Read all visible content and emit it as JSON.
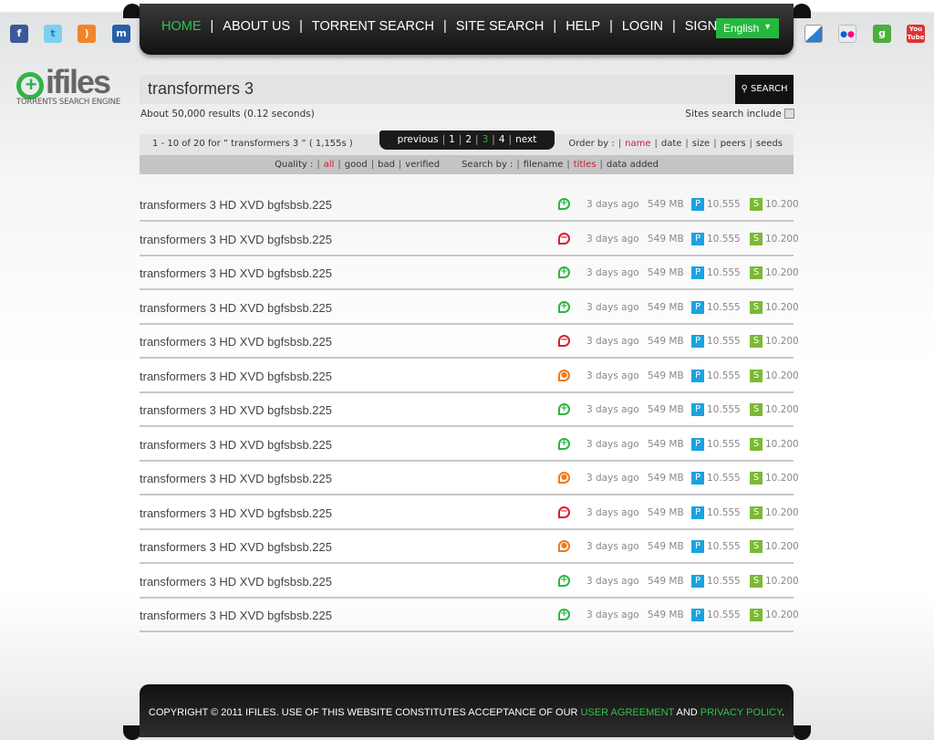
{
  "nav": {
    "items": [
      "HOME",
      "ABOUT US",
      "TORRENT SEARCH",
      "SITE SEARCH",
      "HELP",
      "LOGIN",
      "SIGNIN"
    ],
    "active": 0,
    "language": "English"
  },
  "social_left": [
    "facebook",
    "twitter",
    "rss",
    "myspace"
  ],
  "social_right": [
    "delicious",
    "flickr",
    "google",
    "youtube"
  ],
  "logo": {
    "name": "ifiles",
    "tagline": "TORRENTS SEARCH ENGINE"
  },
  "search": {
    "query": "transformers 3",
    "button": "SEARCH",
    "results_info": "About 50,000 results (0.12 seconds)",
    "sites_include": "Sites search include"
  },
  "summary": "1  -  10  of  20  for ”  transformers 3 ”  (  1,155s  )",
  "pager": {
    "previous": "previous",
    "pages": [
      "1",
      "2",
      "3",
      "4"
    ],
    "current": "3",
    "next": "next"
  },
  "order": {
    "label": "Order by :",
    "options": [
      "name",
      "date",
      "size",
      "peers",
      "seeds"
    ],
    "active": "name"
  },
  "quality": {
    "label": "Quality :",
    "options": [
      "all",
      "good",
      "bad",
      "verified"
    ],
    "active": "all"
  },
  "searchby": {
    "label": "Search by :",
    "options": [
      "filename",
      "titles",
      "data added"
    ],
    "active": "titles"
  },
  "colors": {
    "good": "#2fb545",
    "bad": "#d8202f",
    "unverified": "#f07a1c"
  },
  "results": [
    {
      "title": "transformers 3  HD XVD bgfsbsb.225",
      "status": "good",
      "age": "3 days ago",
      "size": "549 MB",
      "peers": "10.555",
      "seeds": "10.200"
    },
    {
      "title": "transformers 3  HD XVD bgfsbsb.225",
      "status": "bad",
      "age": "3 days ago",
      "size": "549 MB",
      "peers": "10.555",
      "seeds": "10.200"
    },
    {
      "title": "transformers 3  HD XVD bgfsbsb.225",
      "status": "good",
      "age": "3 days ago",
      "size": "549 MB",
      "peers": "10.555",
      "seeds": "10.200"
    },
    {
      "title": "transformers 3  HD XVD bgfsbsb.225",
      "status": "good",
      "age": "3 days ago",
      "size": "549 MB",
      "peers": "10.555",
      "seeds": "10.200"
    },
    {
      "title": "transformers 3  HD XVD bgfsbsb.225",
      "status": "bad",
      "age": "3 days ago",
      "size": "549 MB",
      "peers": "10.555",
      "seeds": "10.200"
    },
    {
      "title": "transformers 3  HD XVD bgfsbsb.225",
      "status": "unverified",
      "age": "3 days ago",
      "size": "549 MB",
      "peers": "10.555",
      "seeds": "10.200"
    },
    {
      "title": "transformers 3  HD XVD bgfsbsb.225",
      "status": "good",
      "age": "3 days ago",
      "size": "549 MB",
      "peers": "10.555",
      "seeds": "10.200"
    },
    {
      "title": "transformers 3  HD XVD bgfsbsb.225",
      "status": "good",
      "age": "3 days ago",
      "size": "549 MB",
      "peers": "10.555",
      "seeds": "10.200"
    },
    {
      "title": "transformers 3  HD XVD bgfsbsb.225",
      "status": "unverified",
      "age": "3 days ago",
      "size": "549 MB",
      "peers": "10.555",
      "seeds": "10.200"
    },
    {
      "title": "transformers 3  HD XVD bgfsbsb.225",
      "status": "bad",
      "age": "3 days ago",
      "size": "549 MB",
      "peers": "10.555",
      "seeds": "10.200"
    },
    {
      "title": "transformers 3  HD XVD bgfsbsb.225",
      "status": "unverified",
      "age": "3 days ago",
      "size": "549 MB",
      "peers": "10.555",
      "seeds": "10.200"
    },
    {
      "title": "transformers 3  HD XVD bgfsbsb.225",
      "status": "good",
      "age": "3 days ago",
      "size": "549 MB",
      "peers": "10.555",
      "seeds": "10.200"
    },
    {
      "title": "transformers 3  HD XVD bgfsbsb.225",
      "status": "good",
      "age": "3 days ago",
      "size": "549 MB",
      "peers": "10.555",
      "seeds": "10.200"
    }
  ],
  "footer": {
    "text": "COPYRIGHT © 2011 IFILES. USE OF THIS WEBSITE CONSTITUTES ACCEPTANCE OF OUR ",
    "link1": "USER AGREEMENT",
    "and": " AND ",
    "link2": "PRIVACY POLICY",
    "end": "."
  }
}
